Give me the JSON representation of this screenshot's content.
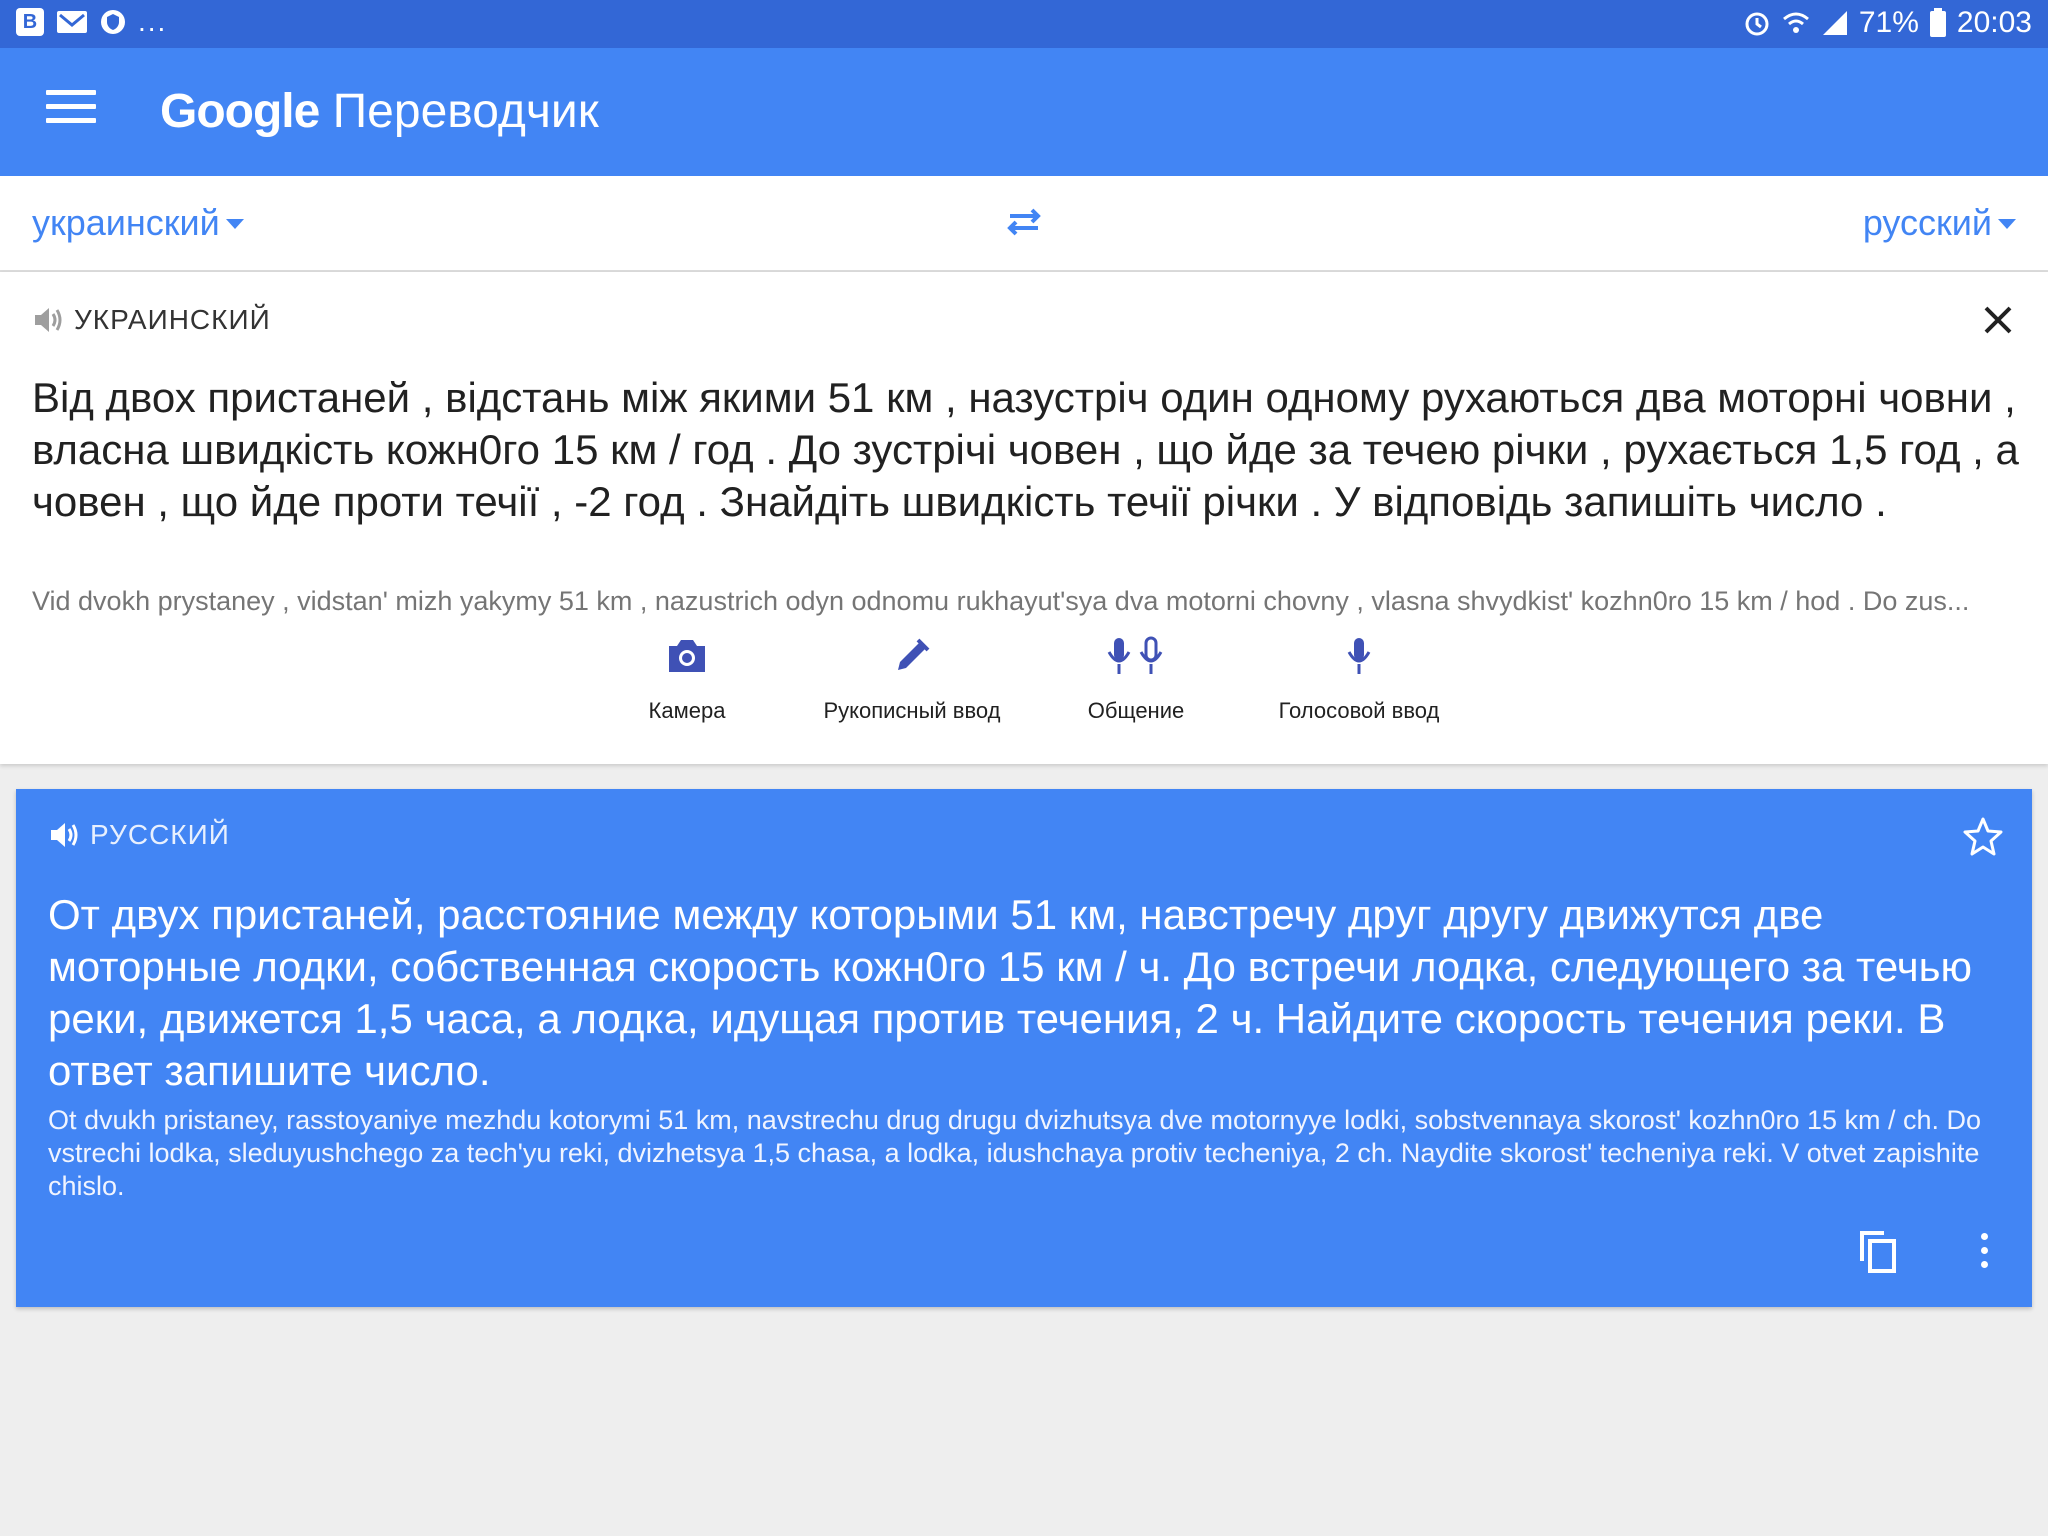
{
  "status_bar": {
    "left_icons": [
      "vk-icon",
      "mail-icon",
      "shield-icon"
    ],
    "more": "...",
    "battery": "71%",
    "time": "20:03"
  },
  "app": {
    "title_brand": "Google",
    "title_product": "Переводчик"
  },
  "languages": {
    "source": "украинский",
    "target": "русский"
  },
  "input": {
    "lang_label": "УКРАИНСКИЙ",
    "text": "Від двох пристаней , відстань між якими 51 км , назустріч один одному рухаються два моторні човни , власна швидкість кожн0го 15 км / год . До зустрічі човен , що йде за течею річки , рухається 1,5 год , а човен , що йде проти течії , -2 год . Знайдіть швидкість течії річки . У відповідь запишіть число .",
    "transliteration": "Vid dvokh prystaney , vidstanʹ mizh yakymy 51 km , nazustrich odyn odnomu rukhayutʹsya dva motorni chovny , vlasna shvydkistʹ kozhn0ro 15 km / hod . Do zus..."
  },
  "tools": [
    {
      "label": "Камера",
      "icon": "camera-icon"
    },
    {
      "label": "Рукописный ввод",
      "icon": "pen-icon"
    },
    {
      "label": "Общение",
      "icon": "conversation-mic-icon"
    },
    {
      "label": "Голосовой ввод",
      "icon": "mic-icon"
    }
  ],
  "output": {
    "lang_label": "РУССКИЙ",
    "text": "От двух пристаней, расстояние между которыми 51 км, навстречу друг другу движутся две моторные лодки, собственная скорость кожн0го 15 км / ч. До встречи лодка, следующего за течью реки, движется 1,5 часа, а лодка, идущая против течения, 2 ч. Найдите скорость течения реки. В ответ запишите число.",
    "transliteration": "Ot dvukh pristaney, rasstoyaniye mezhdu kotorymi 51 km, navstrechu drug drugu dvizhutsya dve motornyye lodki, sobstvennaya skorost' kozhn0ro 15 km / ch. Do vstrechi lodka, sleduyushchego za tech'yu reki, dvizhetsya 1,5 chasa, a lodka, idushchaya protiv techeniya, 2 ch. Naydite skorost' techeniya reki. V otvet zapishite chislo."
  },
  "colors": {
    "status_bar": "#3367d6",
    "app_bar": "#4285f4",
    "accent": "#4285f4",
    "tool_icon": "#3f51b5",
    "background": "#eeeeee"
  }
}
